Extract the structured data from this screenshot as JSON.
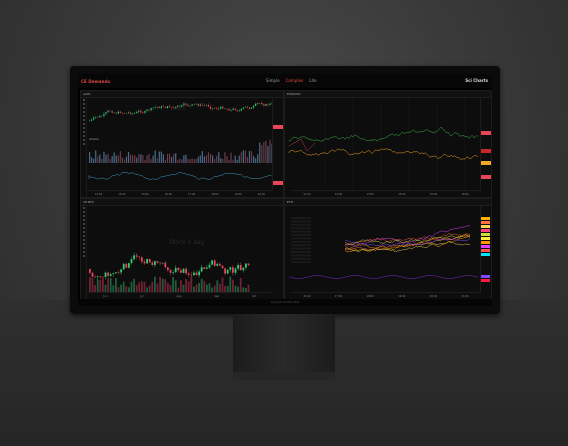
{
  "app": {
    "logo": "CE Demands",
    "brand_right": "Sci Charts",
    "nav": [
      "Simple",
      "Complex",
      "Lite"
    ],
    "nav_active_index": 1
  },
  "panels": {
    "top_left": {
      "symbol": "AAPL",
      "watermark": "AAPL",
      "sub_pane_label": "Volume",
      "x_ticks": [
        "13:00",
        "14:00",
        "15:00",
        "16:00",
        "17:00",
        "18:00",
        "19:00",
        "20:00"
      ]
    },
    "top_right": {
      "symbol": "EUR/USD",
      "x_ticks": [
        "11:00",
        "12:00",
        "13:00",
        "14:00",
        "15:00",
        "16:00"
      ]
    },
    "bottom_left": {
      "symbol": "1H BTC",
      "watermark": "Stock 1 day",
      "x_ticks": [
        "Jun",
        "Jul",
        "Aug",
        "Sep",
        "Oct"
      ]
    },
    "bottom_right": {
      "symbol": "ETH",
      "x_ticks": [
        "15:00",
        "17:00",
        "18:00",
        "19:00",
        "20:00",
        "21:00"
      ]
    }
  },
  "colors": {
    "accent": "#e84a3b",
    "candle_up": "#2ecc71",
    "candle_down": "#e8455a",
    "green_series": "#3cb043",
    "orange_series": "#f5a623",
    "pink_tag": "#ff3d7f",
    "purple": "#9b30ff"
  },
  "footer": "Copyright SciChart 2024"
}
